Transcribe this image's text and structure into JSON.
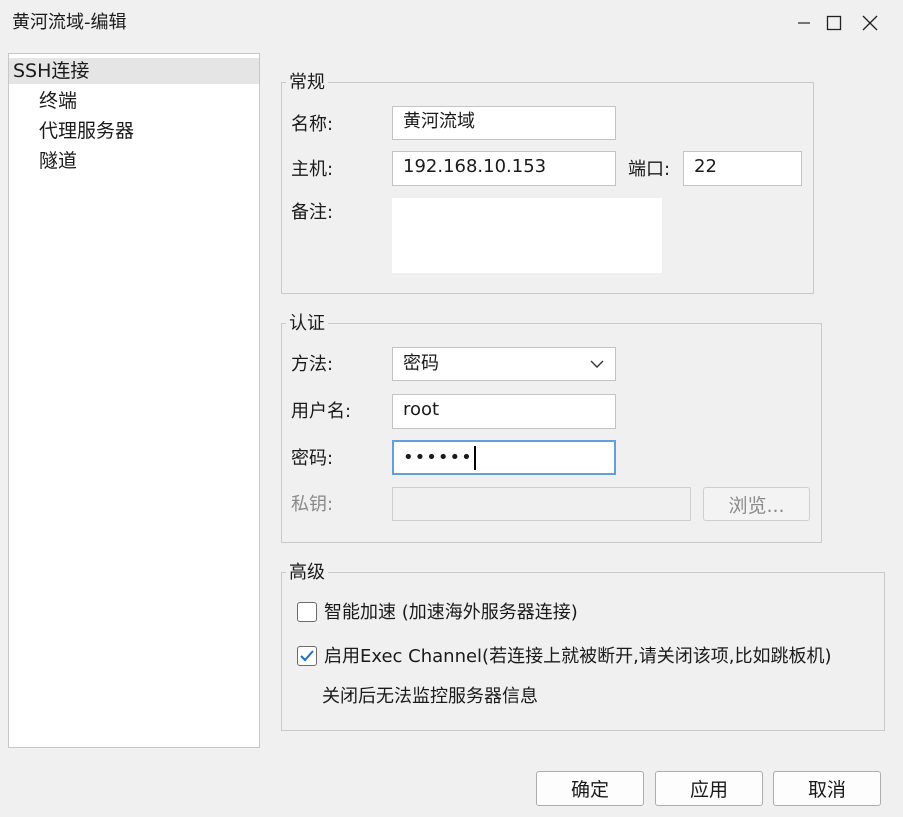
{
  "window": {
    "title": "黄河流域-编辑",
    "minimize_icon": "minimize-icon",
    "maximize_icon": "maximize-icon",
    "close_icon": "close-icon"
  },
  "tree": {
    "items": [
      {
        "label": "SSH连接",
        "selected": true
      },
      {
        "label": "终端"
      },
      {
        "label": "代理服务器"
      },
      {
        "label": "隧道"
      }
    ]
  },
  "general": {
    "title": "常规",
    "name_label": "名称:",
    "name_value": "黄河流域",
    "host_label": "主机:",
    "host_value": "192.168.10.153",
    "port_label": "端口:",
    "port_value": "22",
    "note_label": "备注:",
    "note_value": ""
  },
  "auth": {
    "title": "认证",
    "method_label": "方法:",
    "method_value": "密码",
    "user_label": "用户名:",
    "user_value": "root",
    "password_label": "密码:",
    "password_value": "••••••",
    "key_label": "私钥:",
    "key_value": "",
    "browse_label": "浏览..."
  },
  "advanced": {
    "title": "高级",
    "smart_accel_label": "智能加速 (加速海外服务器连接)",
    "smart_accel_checked": false,
    "exec_channel_label": "启用Exec Channel(若连接上就被断开,请关闭该项,比如跳板机)",
    "exec_channel_checked": true,
    "exec_channel_note": "关闭后无法监控服务器信息"
  },
  "footer": {
    "ok_label": "确定",
    "apply_label": "应用",
    "cancel_label": "取消"
  },
  "colors": {
    "accent": "#1a6fc6",
    "focus_border": "#62a0dc"
  }
}
